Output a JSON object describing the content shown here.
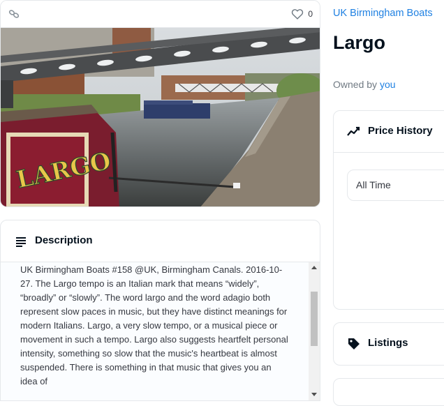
{
  "collection": {
    "name": "UK Birmingham Boats"
  },
  "item": {
    "title": "Largo"
  },
  "owner": {
    "prefix": "Owned by ",
    "name": "you"
  },
  "media": {
    "favorites_count": "0",
    "boat_sign_text": "LARGO"
  },
  "description": {
    "title": "Description",
    "text": "UK Birmingham Boats #158 @UK, Birmingham Canals. 2016-10-27. The Largo tempo is an Italian mark that means “widely”, “broadly” or “slowly”. The word largo and the word adagio both represent slow paces in music, but they have distinct meanings for modern Italians. Largo, a very slow tempo, or a musical piece or movement in such a tempo. Largo also suggests heartfelt personal intensity, something so slow that the music's heartbeat is almost suspended. There is something in that music that gives you an idea of"
  },
  "price_history": {
    "title": "Price History",
    "range_value": "All Time"
  },
  "listings": {
    "title": "Listings"
  },
  "colors": {
    "link": "#2081e2",
    "text": "#04111d",
    "muted": "#707a83",
    "border": "#e5e8eb"
  },
  "icons": [
    "chain-link-icon",
    "heart-icon",
    "description-lines-icon",
    "trending-line-icon",
    "tag-icon"
  ]
}
